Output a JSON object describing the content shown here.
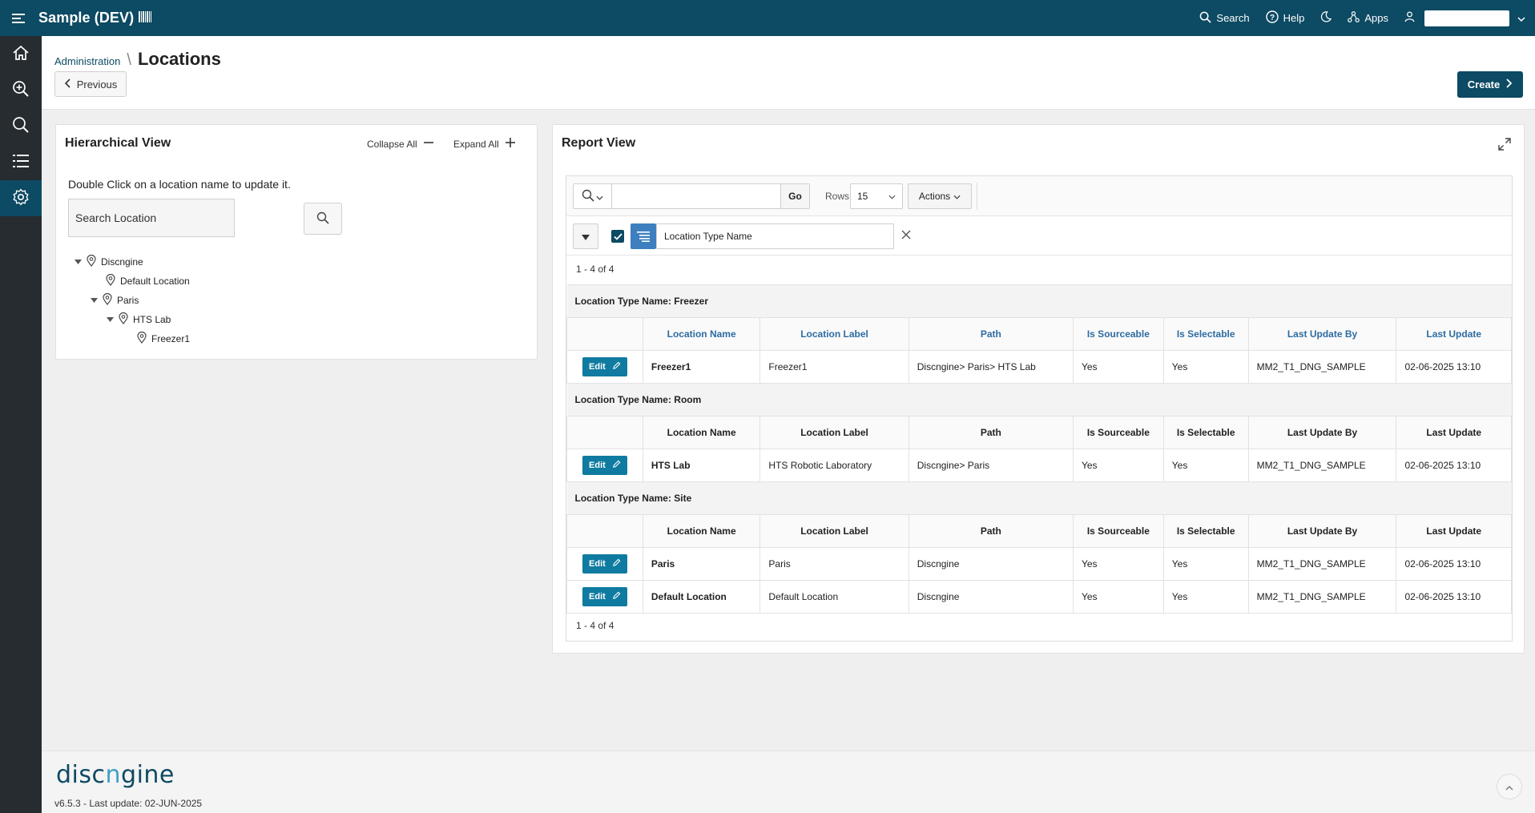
{
  "app": {
    "title": "Sample (DEV)"
  },
  "topbar": {
    "search_label": "Search",
    "help_label": "Help",
    "apps_label": "Apps"
  },
  "sidenav": [
    "home-icon",
    "zoom-in-icon",
    "search-icon",
    "list-icon",
    "settings-icon"
  ],
  "breadcrumb": {
    "parent": "Administration",
    "current": "Locations"
  },
  "header": {
    "previous_label": "Previous",
    "create_label": "Create"
  },
  "hierarchical": {
    "title": "Hierarchical View",
    "collapse_all": "Collapse All",
    "expand_all": "Expand All",
    "hint": "Double Click on a location name to update it.",
    "search_placeholder": "Search Location",
    "tree": [
      {
        "label": "Discngine"
      },
      {
        "label": "Default Location"
      },
      {
        "label": "Paris"
      },
      {
        "label": "HTS Lab"
      },
      {
        "label": "Freezer1"
      }
    ]
  },
  "report": {
    "title": "Report View",
    "go_label": "Go",
    "rows_label": "Rows",
    "rows_value": "15",
    "actions_label": "Actions",
    "filter_text": "Location Type Name",
    "pagination": "1 - 4 of 4",
    "edit_label": "Edit",
    "columns": [
      "Location Name",
      "Location Label",
      "Path",
      "Is Sourceable",
      "Is Selectable",
      "Last Update By",
      "Last Update"
    ],
    "groups": [
      {
        "title": "Location Type Name: Freezer",
        "rows": [
          [
            "Freezer1",
            "Freezer1",
            "Discngine> Paris> HTS Lab",
            "Yes",
            "Yes",
            "MM2_T1_DNG_SAMPLE",
            "02-06-2025 13:10"
          ]
        ]
      },
      {
        "title": "Location Type Name: Room",
        "rows": [
          [
            "HTS Lab",
            "HTS Robotic Laboratory",
            "Discngine> Paris",
            "Yes",
            "Yes",
            "MM2_T1_DNG_SAMPLE",
            "02-06-2025 13:10"
          ]
        ]
      },
      {
        "title": "Location Type Name: Site",
        "rows": [
          [
            "Paris",
            "Paris",
            "Discngine",
            "Yes",
            "Yes",
            "MM2_T1_DNG_SAMPLE",
            "02-06-2025 13:10"
          ],
          [
            "Default Location",
            "Default Location",
            "Discngine",
            "Yes",
            "Yes",
            "MM2_T1_DNG_SAMPLE",
            "02-06-2025 13:10"
          ]
        ]
      }
    ]
  },
  "footer": {
    "logo_a": "disc",
    "logo_n": "n",
    "logo_b": "gine",
    "version": "v6.5.3 - Last update: 02-JUN-2025"
  },
  "colors": {
    "brand": "#0d4a63",
    "sidenav": "#262c30",
    "edit": "#0f7ba0",
    "sort_header": "#2d6ca2"
  }
}
